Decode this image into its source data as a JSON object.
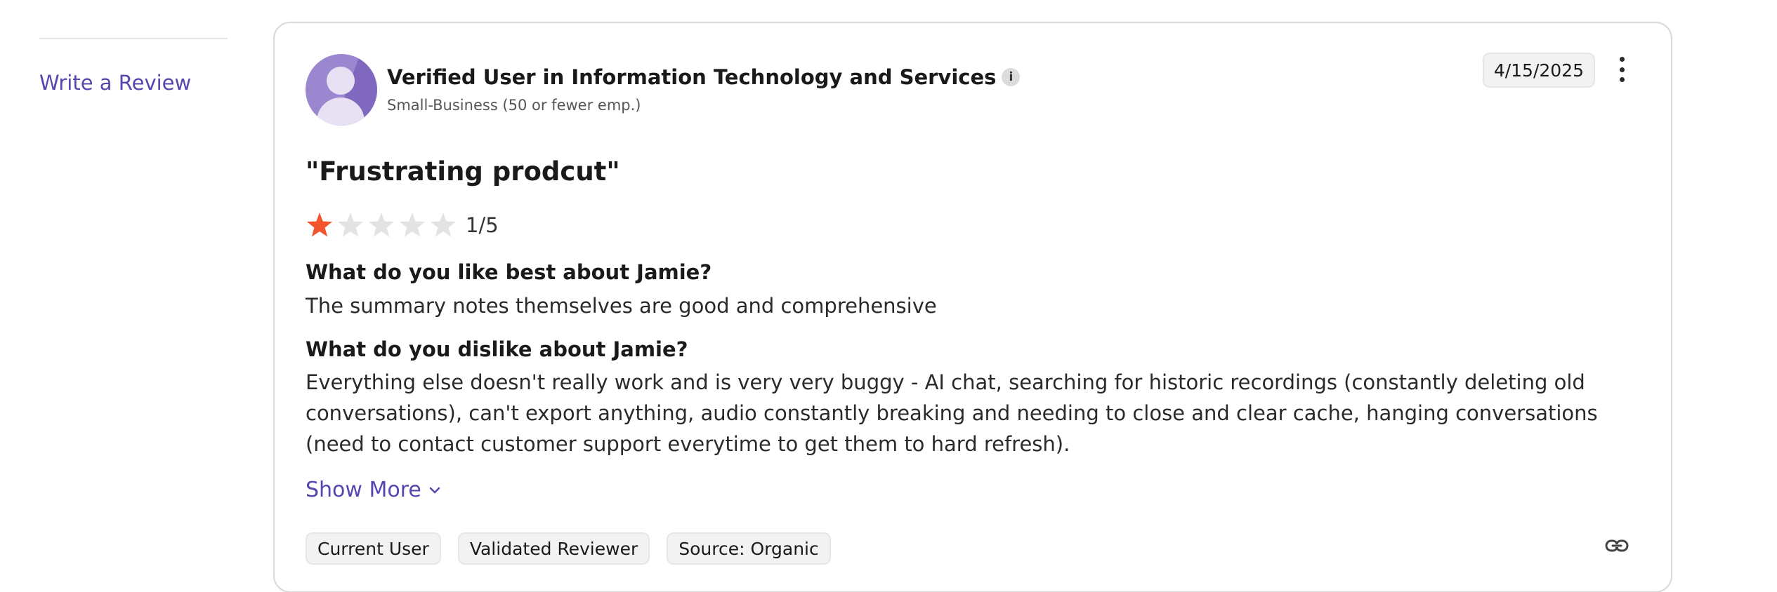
{
  "sidebar": {
    "write_review_label": "Write a Review"
  },
  "review": {
    "reviewer_name": "Verified User in Information Technology and Services",
    "info_icon_glyph": "i",
    "company_size": "Small-Business (50 or fewer emp.)",
    "date": "4/15/2025",
    "title": "\"Frustrating prodcut\"",
    "rating": 1,
    "rating_max": 5,
    "rating_text": "1/5",
    "star_color_filled": "#f2542d",
    "star_color_empty": "#e3e3e3",
    "questions": [
      {
        "question": "What do you like best about Jamie?",
        "answer": "The summary notes themselves are good and comprehensive"
      },
      {
        "question": "What do you dislike about Jamie?",
        "answer": "Everything else doesn't really work and is very very buggy - AI chat, searching for historic recordings (constantly deleting old conversations), can't export anything, audio constantly breaking and needing to close and clear cache, hanging conversations (need to contact customer support everytime to get them to hard refresh)."
      }
    ],
    "show_more_label": "Show More",
    "tags": [
      "Current User",
      "Validated Reviewer",
      "Source: Organic"
    ],
    "icons": {
      "avatar": "user-avatar-icon",
      "info": "info-icon",
      "menu": "more-vertical-icon",
      "expand": "chevron-down-icon",
      "link": "link-icon"
    }
  },
  "colors": {
    "link": "#5746af",
    "card_border": "#d9d9d9",
    "badge_bg": "#f2f2f2"
  }
}
